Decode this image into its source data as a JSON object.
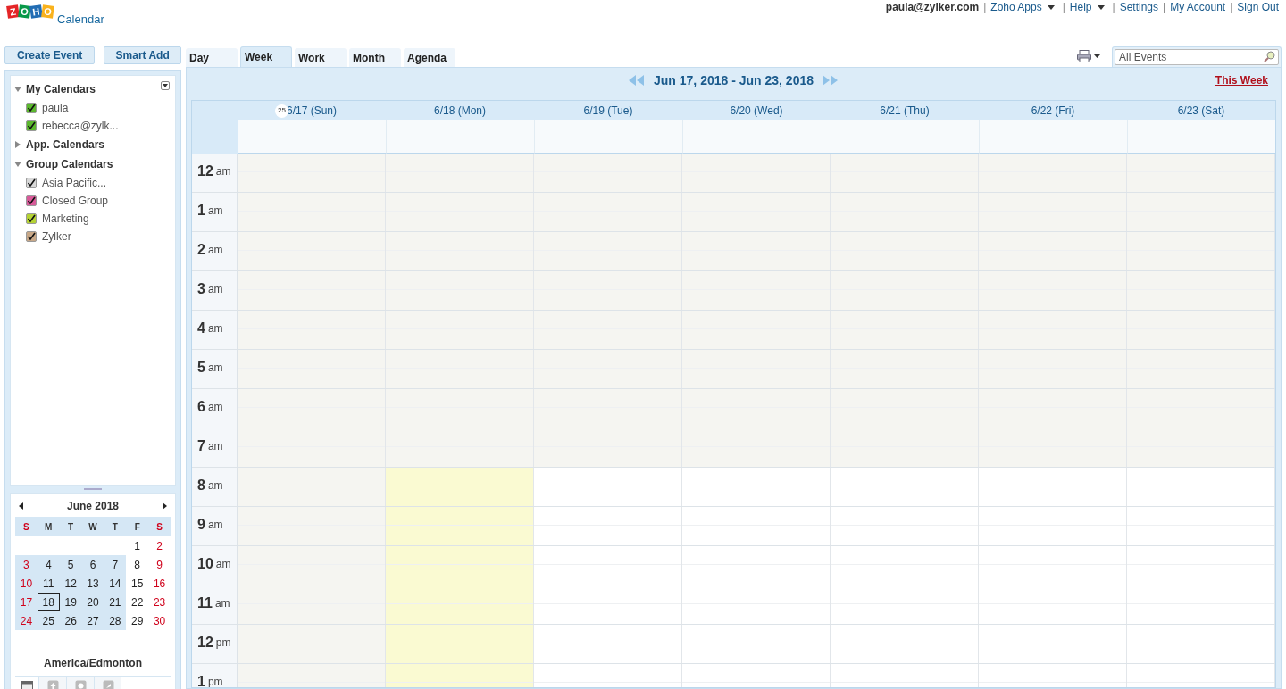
{
  "logo": {
    "letters": [
      "Z",
      "O",
      "H",
      "O"
    ],
    "product": "Calendar"
  },
  "top_links": {
    "user": "paula@zylker.com",
    "links": [
      {
        "separator": "|",
        "label": "Zoho Apps",
        "menu": true
      },
      {
        "separator": "|",
        "label": "Help",
        "menu": true
      },
      {
        "separator": "|",
        "label": "Settings",
        "menu": false
      },
      {
        "separator": "|",
        "label": "My Account",
        "menu": false
      },
      {
        "separator": "|",
        "label": "Sign Out",
        "menu": false
      }
    ]
  },
  "actions": [
    "Create Event",
    "Smart Add"
  ],
  "tabs": [
    {
      "label": "Day",
      "selected": false
    },
    {
      "label": "Week",
      "selected": true
    },
    {
      "label": "Work",
      "selected": false
    },
    {
      "label": "Month",
      "selected": false
    },
    {
      "label": "Agenda",
      "selected": false
    }
  ],
  "search": {
    "placeholder": "All Events"
  },
  "sidebar": {
    "sections": [
      {
        "title": "My Calendars",
        "expanded": true,
        "items": [
          {
            "label": "paula",
            "checked": true,
            "color": "#5cb82e"
          },
          {
            "label": "rebecca@zylk...",
            "checked": true,
            "color": "#5cb82e"
          }
        ]
      },
      {
        "title": "App. Calendars",
        "expanded": false
      },
      {
        "title": "Group Calendars",
        "expanded": true,
        "items": [
          {
            "label": "Asia Pacific...",
            "checked": true,
            "color": "#d8d8d8"
          },
          {
            "label": "Closed Group",
            "checked": true,
            "color": "#d95a9a"
          },
          {
            "label": "Marketing",
            "checked": true,
            "color": "#b5d334"
          },
          {
            "label": "Zylker",
            "checked": true,
            "color": "#c8a888"
          }
        ]
      }
    ]
  },
  "mini_calendar": {
    "title": "June 2018",
    "weekdays": [
      {
        "label": "S",
        "weekend": true
      },
      {
        "label": "M",
        "weekend": false
      },
      {
        "label": "T",
        "weekend": false
      },
      {
        "label": "W",
        "weekend": false
      },
      {
        "label": "T",
        "weekend": false
      },
      {
        "label": "F",
        "weekend": false
      },
      {
        "label": "S",
        "weekend": true
      }
    ],
    "weeks": [
      {
        "highlighted": false,
        "days": [
          {
            "label": "1",
            "today": false
          },
          {
            "label": "2",
            "today": false
          }
        ]
      },
      {
        "highlighted": true,
        "days": [
          {
            "label": "3",
            "today": false
          },
          {
            "label": "4",
            "today": false
          },
          {
            "label": "5",
            "today": false
          },
          {
            "label": "6",
            "today": false
          },
          {
            "label": "7",
            "today": false
          },
          {
            "label": "8",
            "today": false
          },
          {
            "label": "9",
            "today": false
          }
        ]
      },
      {
        "highlighted": true,
        "days": [
          {
            "label": "10",
            "today": false
          },
          {
            "label": "11",
            "today": false
          },
          {
            "label": "12",
            "today": false
          },
          {
            "label": "13",
            "today": false
          },
          {
            "label": "14",
            "today": false
          },
          {
            "label": "15",
            "today": false
          },
          {
            "label": "16",
            "today": false
          }
        ]
      },
      {
        "highlighted": true,
        "days": [
          {
            "label": "17",
            "today": false
          },
          {
            "label": "18",
            "today": true
          },
          {
            "label": "19",
            "today": false
          },
          {
            "label": "20",
            "today": false
          },
          {
            "label": "21",
            "today": false
          },
          {
            "label": "22",
            "today": false
          },
          {
            "label": "23",
            "today": false
          }
        ]
      },
      {
        "highlighted": true,
        "days": [
          {
            "label": "24",
            "today": false
          },
          {
            "label": "25",
            "today": false
          },
          {
            "label": "26",
            "today": false
          },
          {
            "label": "27",
            "today": false
          },
          {
            "label": "28",
            "today": false
          },
          {
            "label": "29",
            "today": false
          },
          {
            "label": "30",
            "today": false
          }
        ]
      }
    ],
    "timezone": "America/Edmonton"
  },
  "week_nav": {
    "range": "Jun 17, 2018 - Jun 23, 2018",
    "this_week": "This Week",
    "week_number": "25"
  },
  "days": [
    {
      "label": "6/17 (Sun)",
      "kind": "off"
    },
    {
      "label": "6/18 (Mon)",
      "kind": "today"
    },
    {
      "label": "6/19 (Tue)",
      "kind": "work"
    },
    {
      "label": "6/20 (Wed)",
      "kind": "work"
    },
    {
      "label": "6/21 (Thu)",
      "kind": "work"
    },
    {
      "label": "6/22 (Fri)",
      "kind": "work"
    },
    {
      "label": "6/23 (Sat)",
      "kind": "work"
    }
  ],
  "hours": [
    {
      "number": "12",
      "suffix": "am",
      "shaded": true
    },
    {
      "number": "1",
      "suffix": "am",
      "shaded": true
    },
    {
      "number": "2",
      "suffix": "am",
      "shaded": true
    },
    {
      "number": "3",
      "suffix": "am",
      "shaded": true
    },
    {
      "number": "4",
      "suffix": "am",
      "shaded": true
    },
    {
      "number": "5",
      "suffix": "am",
      "shaded": true
    },
    {
      "number": "6",
      "suffix": "am",
      "shaded": true
    },
    {
      "number": "7",
      "suffix": "am",
      "shaded": true
    },
    {
      "number": "8",
      "suffix": "am",
      "shaded": false
    },
    {
      "number": "9",
      "suffix": "am",
      "shaded": false
    },
    {
      "number": "10",
      "suffix": "am",
      "shaded": false
    },
    {
      "number": "11",
      "suffix": "am",
      "shaded": false
    },
    {
      "number": "12",
      "suffix": "pm",
      "shaded": false
    },
    {
      "number": "1",
      "suffix": "pm",
      "shaded": false
    }
  ]
}
